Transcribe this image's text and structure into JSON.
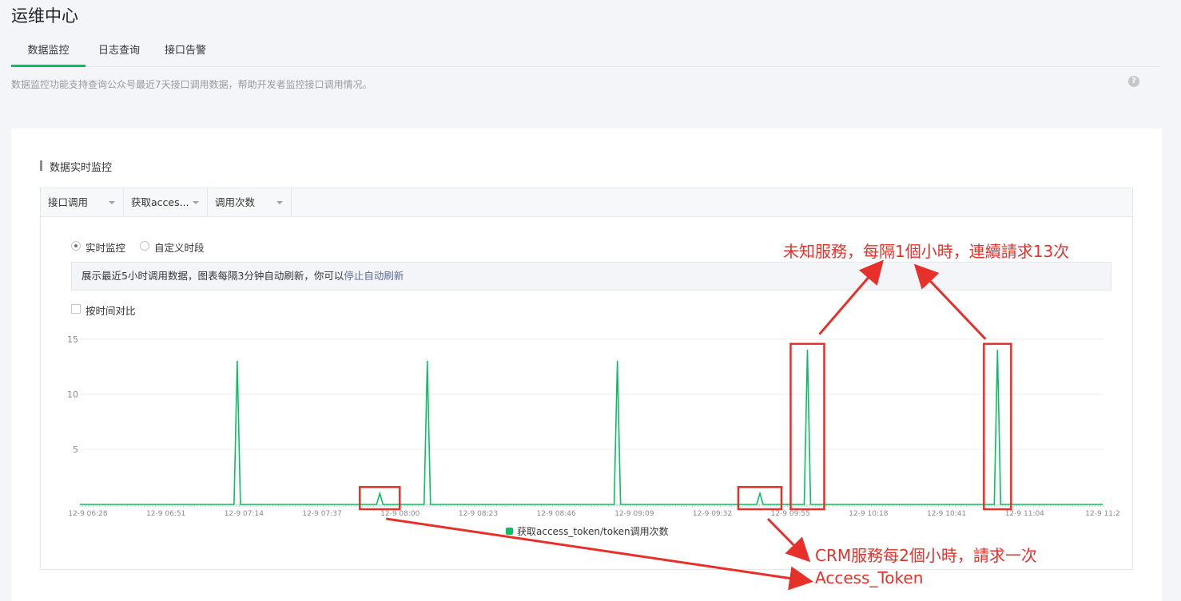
{
  "page": {
    "title": "运维中心"
  },
  "tabs": [
    {
      "label": "数据监控",
      "active": true
    },
    {
      "label": "日志查询",
      "active": false
    },
    {
      "label": "接口告警",
      "active": false
    }
  ],
  "intro": "数据监控功能支持查询公众号最近7天接口调用数据，帮助开发者监控接口调用情况。",
  "help_icon": "question-circle-icon",
  "section": {
    "title": "数据实时监控"
  },
  "filters": [
    {
      "value": "接口调用"
    },
    {
      "value": "获取acces..."
    },
    {
      "value": "调用次数"
    }
  ],
  "mode": {
    "options": [
      {
        "label": "实时监控",
        "checked": true
      },
      {
        "label": "自定义时段",
        "checked": false
      }
    ]
  },
  "notice": {
    "text": "展示最近5小时调用数据，图表每隔3分钟自动刷新，你可以",
    "link": "停止自动刷新"
  },
  "compare": {
    "label": "按时间对比",
    "checked": false
  },
  "colors": {
    "accent": "#07c160",
    "annotation": "#e8302a",
    "link": "#576b95"
  },
  "chart_data": {
    "type": "line",
    "x_tick_labels": [
      "12-9 06:28",
      "12-9 06:51",
      "12-9 07:14",
      "12-9 07:37",
      "12-9 08:00",
      "12-9 08:23",
      "12-9 08:46",
      "12-9 09:09",
      "12-9 09:32",
      "12-9 09:55",
      "12-9 10:18",
      "12-9 10:41",
      "12-9 11:04",
      "12-9 11:2"
    ],
    "y_ticks": [
      5,
      10,
      15
    ],
    "ylim": [
      0,
      15
    ],
    "series": [
      {
        "name": "获取access_token/token调用次数",
        "points": [
          {
            "minute": 44,
            "value": 13
          },
          {
            "minute": 86,
            "value": 1
          },
          {
            "minute": 100,
            "value": 13
          },
          {
            "minute": 156,
            "value": 13
          },
          {
            "minute": 198,
            "value": 1
          },
          {
            "minute": 212,
            "value": 14
          },
          {
            "minute": 268,
            "value": 14
          }
        ]
      }
    ],
    "annotations": [
      {
        "text": "未知服務，每隔1個小時，連續請求13次"
      },
      {
        "text": "CRM服務每2個小時，請求一次"
      },
      {
        "text": "Access_Token"
      }
    ]
  }
}
